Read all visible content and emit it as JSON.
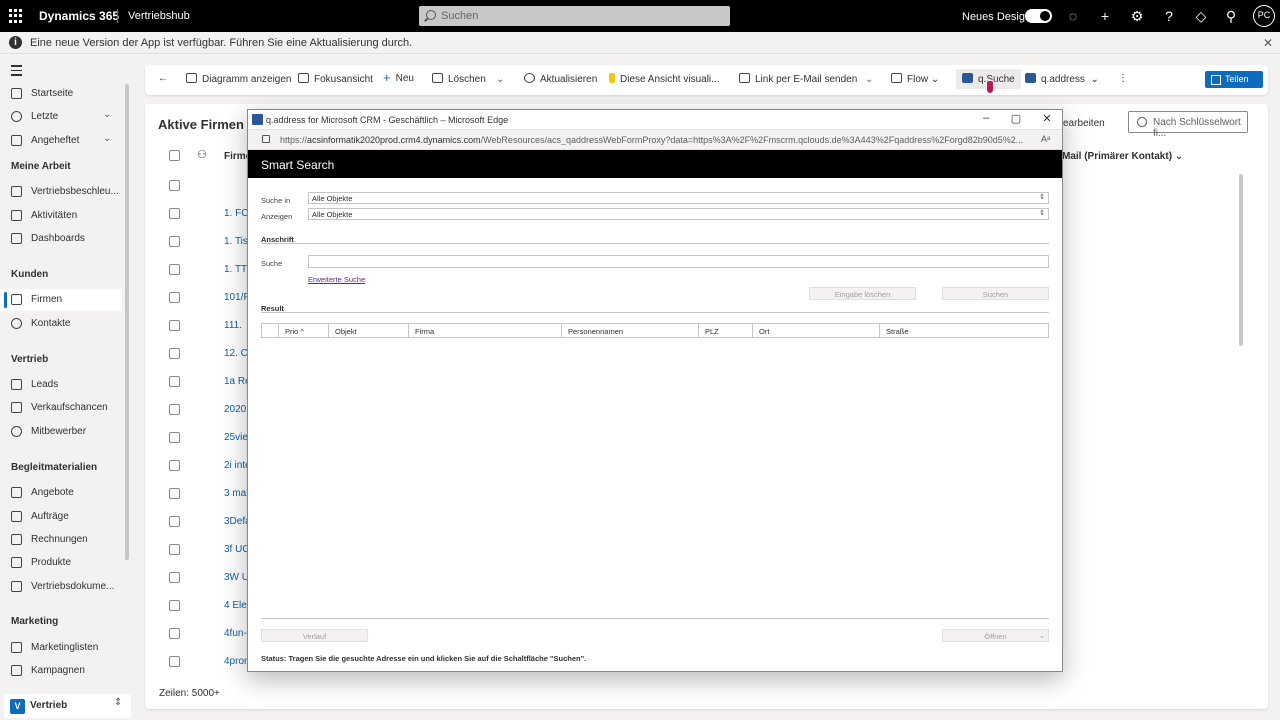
{
  "topbar": {
    "brand": "Dynamics 365",
    "app": "Vertriebshub",
    "search_placeholder": "Suchen",
    "new_design": "Neues Design",
    "avatar": "PC"
  },
  "notice": {
    "text": "Eine neue Version der App ist verfügbar. Führen Sie eine Aktualisierung durch."
  },
  "sidebar": {
    "items_top": [
      {
        "label": "Startseite"
      },
      {
        "label": "Letzte"
      },
      {
        "label": "Angeheftet"
      }
    ],
    "sections": [
      {
        "title": "Meine Arbeit",
        "items": [
          "Vertriebsbeschleu...",
          "Aktivitäten",
          "Dashboards"
        ]
      },
      {
        "title": "Kunden",
        "items": [
          "Firmen",
          "Kontakte"
        ]
      },
      {
        "title": "Vertrieb",
        "items": [
          "Leads",
          "Verkaufschancen",
          "Mitbewerber"
        ]
      },
      {
        "title": "Begleitmaterialien",
        "items": [
          "Angebote",
          "Aufträge",
          "Rechnungen",
          "Produkte",
          "Vertriebsdokume..."
        ]
      },
      {
        "title": "Marketing",
        "items": [
          "Marketinglisten",
          "Kampagnen"
        ]
      }
    ],
    "area": {
      "badge": "V",
      "label": "Vertrieb"
    }
  },
  "commands": {
    "chart": "Diagramm anzeigen",
    "focus": "Fokusansicht",
    "new": "Neu",
    "delete": "Löschen",
    "refresh": "Aktualisieren",
    "visualize": "Diese Ansicht visuali...",
    "email_link": "Link per E-Mail senden",
    "flow": "Flow",
    "qsuche": "q.Suche",
    "qaddress": "q.address",
    "share": "Teilen"
  },
  "grid": {
    "title": "Aktive Firmen",
    "edit": "earbeiten",
    "keyword_placeholder": "Nach Schlüsselwort fi...",
    "col_name": "Firme",
    "col_mail": "Mail (Primärer Kontakt)",
    "rows": [
      "",
      "1. FC",
      "1. Tis",
      "1. TT",
      "101/F",
      "111.",
      "12. C",
      "1a Re",
      "20202",
      "25vie",
      "2i inte",
      "3 mal",
      "3Defa",
      "3f UG",
      "3W U",
      "4 Ele",
      "4fun-",
      "4prom"
    ],
    "footer": "Zeilen: 5000+"
  },
  "popup": {
    "window_title": "q.address for Microsoft CRM - Geschäftlich – Microsoft Edge",
    "url_prefix": "https://",
    "url_host": "acsinformatik2020prod.crm4.dynamics.com",
    "url_rest": "/WebResources/acs_qaddressWebFormProxy?data=https%3A%2F%2Fmscrm.qclouds.de%3A443%2Fqaddress%2Forgd82b90d5%2...",
    "header": "Smart Search",
    "search_in_label": "Suche in",
    "search_in_value": "Alle Objekte",
    "show_label": "Anzeigen",
    "show_value": "Alle Objekte",
    "address_section": "Anschrift",
    "search_label": "Suche",
    "advanced_link": "Erweiterte Suche",
    "clear_button": "Eingabe löschen",
    "search_button": "Suchen",
    "result_section": "Result",
    "columns": [
      "Prio ^",
      "Objekt",
      "Firma",
      "Personennamen",
      "PLZ",
      "Ort",
      "Straße"
    ],
    "history_button": "Verlauf",
    "open_button": "Öffnen",
    "status": "Status: Tragen Sie die gesuchte Adresse ein und klicken Sie auf die Schaltfläche \"Suchen\"."
  }
}
